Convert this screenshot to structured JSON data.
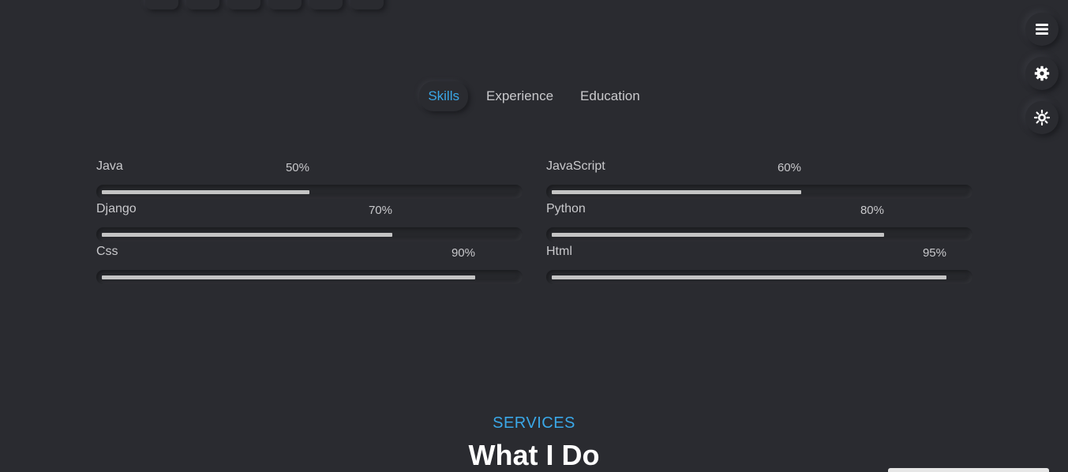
{
  "tabs": [
    {
      "label": "Skills",
      "active": true
    },
    {
      "label": "Experience",
      "active": false
    },
    {
      "label": "Education",
      "active": false
    }
  ],
  "skills": [
    {
      "name": "Java",
      "percent_label": "50%",
      "value": 50
    },
    {
      "name": "JavaScript",
      "percent_label": "60%",
      "value": 60
    },
    {
      "name": "Django",
      "percent_label": "70%",
      "value": 70
    },
    {
      "name": "Python",
      "percent_label": "80%",
      "value": 80
    },
    {
      "name": "Css",
      "percent_label": "90%",
      "value": 90
    },
    {
      "name": "Html",
      "percent_label": "95%",
      "value": 95
    }
  ],
  "services": {
    "label": "SERVICES",
    "title": "What I Do"
  },
  "side_controls": [
    {
      "icon": "menu-icon"
    },
    {
      "icon": "gear-icon"
    },
    {
      "icon": "sun-icon"
    }
  ],
  "colors": {
    "accent": "#3aa8e8",
    "background": "#2a2b30",
    "bar_fill": "#c4c4c4"
  }
}
